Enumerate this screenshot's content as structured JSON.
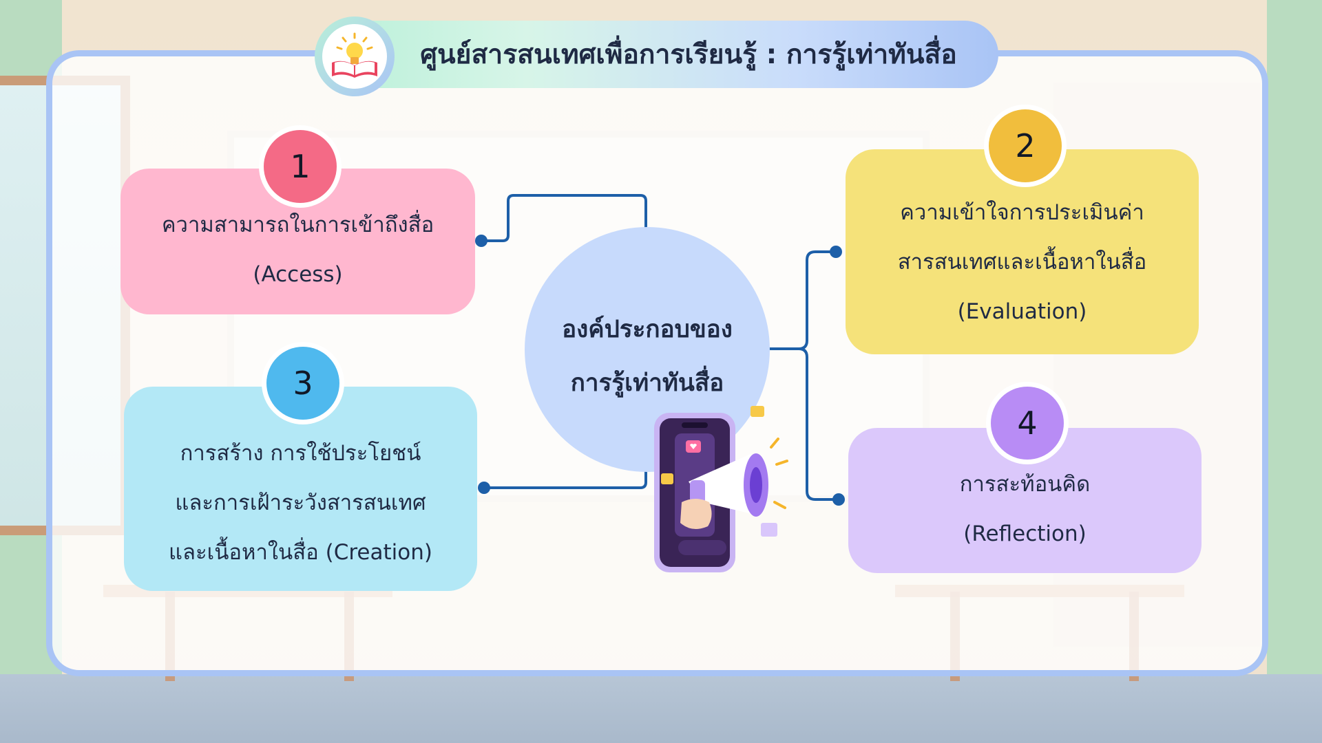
{
  "header": {
    "title": "ศูนย์สารสนเทศเพื่อการเรียนรู้ : การรู้เท่าทันสื่อ",
    "icon": "book-lightbulb-icon"
  },
  "center": {
    "line1": "องค์ประกอบของ",
    "line2": "การรู้เท่าทันสื่อ",
    "illustration": "phone-megaphone-icon"
  },
  "items": [
    {
      "number": "1",
      "line1": "ความสามารถในการเข้าถึงสื่อ",
      "line2": "(Access)",
      "color": "#ffb7cf",
      "badge_color": "#f46a86"
    },
    {
      "number": "2",
      "line1": "ความเข้าใจการประเมินค่า",
      "line2": "สารสนเทศและเนื้อหาในสื่อ",
      "line3": "(Evaluation)",
      "color": "#f5e27a",
      "badge_color": "#f1be3d"
    },
    {
      "number": "3",
      "line1": "การสร้าง การใช้ประโยชน์",
      "line2": "และการเฝ้าระวังสารสนเทศ",
      "line3": "และเนื้อหาในสื่อ (Creation)",
      "color": "#b3e8f6",
      "badge_color": "#4fb9ee"
    },
    {
      "number": "4",
      "line1": "การสะท้อนคิด",
      "line2": "(Reflection)",
      "color": "#dbc8fb",
      "badge_color": "#b88cf5"
    }
  ],
  "colors": {
    "panel_border": "#a9c4f5",
    "connector": "#1d5fa8",
    "center_fill": "#c7dafc"
  }
}
